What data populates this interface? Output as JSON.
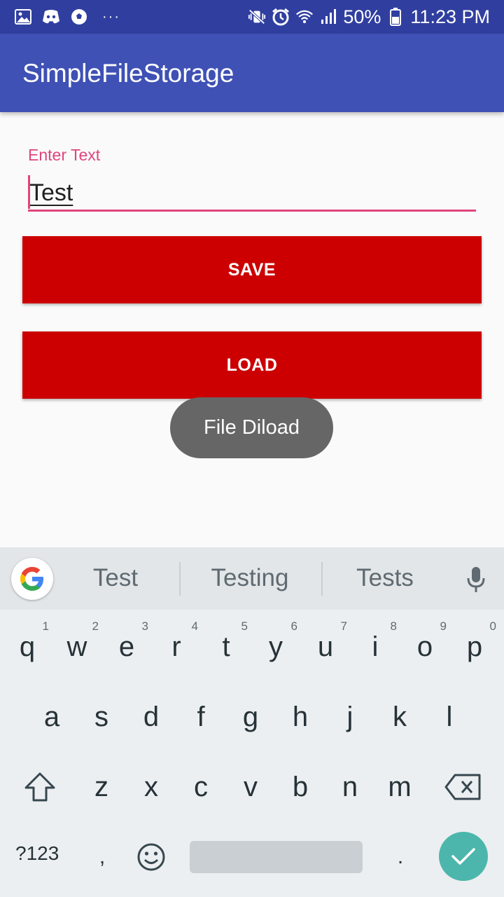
{
  "status_bar": {
    "left_icons": [
      "image-icon",
      "discord-icon",
      "soccer-ball-icon",
      "more-dots-icon"
    ],
    "more_dots": "···",
    "right_icons": [
      "mute-vibrate-icon",
      "alarm-icon",
      "wifi-icon",
      "signal-icon"
    ],
    "battery_percent": "50%",
    "time": "11:23 PM"
  },
  "app_bar": {
    "title": "SimpleFileStorage"
  },
  "form": {
    "label": "Enter Text",
    "value": "Test"
  },
  "buttons": {
    "save": "SAVE",
    "load": "LOAD"
  },
  "toast": {
    "message": "File Diload"
  },
  "keyboard": {
    "suggestions": [
      "Test",
      "Testing",
      "Tests"
    ],
    "row1": [
      {
        "k": "q",
        "n": "1"
      },
      {
        "k": "w",
        "n": "2"
      },
      {
        "k": "e",
        "n": "3"
      },
      {
        "k": "r",
        "n": "4"
      },
      {
        "k": "t",
        "n": "5"
      },
      {
        "k": "y",
        "n": "6"
      },
      {
        "k": "u",
        "n": "7"
      },
      {
        "k": "i",
        "n": "8"
      },
      {
        "k": "o",
        "n": "9"
      },
      {
        "k": "p",
        "n": "0"
      }
    ],
    "row2": [
      "a",
      "s",
      "d",
      "f",
      "g",
      "h",
      "j",
      "k",
      "l"
    ],
    "row3": [
      "z",
      "x",
      "c",
      "v",
      "b",
      "n",
      "m"
    ],
    "symbols_key": "?123",
    "comma_key": ",",
    "period_key": ".",
    "accent_color": "#4db6ac"
  },
  "colors": {
    "status_bar": "#303f9f",
    "app_bar": "#3f51b5",
    "button": "#cc0000",
    "accent": "#e0457b"
  }
}
